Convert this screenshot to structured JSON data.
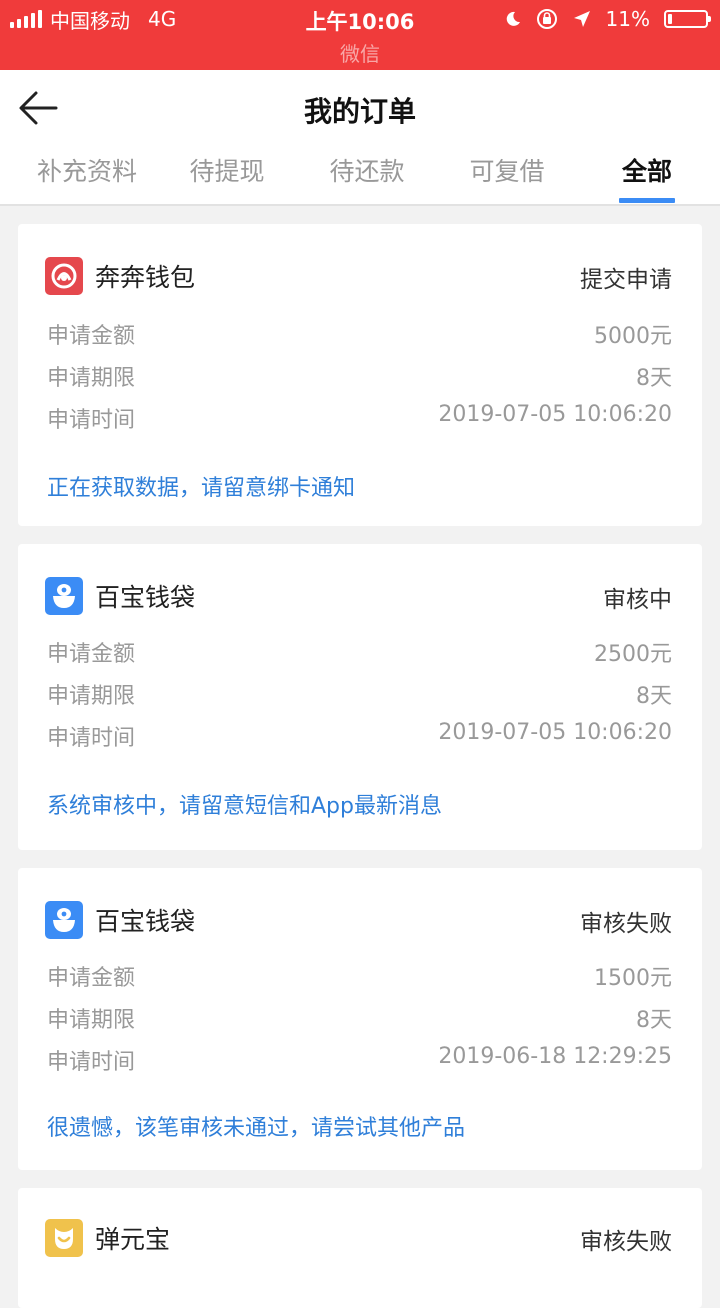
{
  "status_bar": {
    "carrier": "中国移动",
    "network": "4G",
    "time": "上午10:06",
    "app_name": "微信",
    "battery": "11%",
    "battery_level": 0.11
  },
  "header": {
    "title": "我的订单",
    "tabs": [
      {
        "label": "补充资料",
        "active": false
      },
      {
        "label": "待提现",
        "active": false
      },
      {
        "label": "待还款",
        "active": false
      },
      {
        "label": "可复借",
        "active": false
      },
      {
        "label": "全部",
        "active": true
      }
    ]
  },
  "orders": [
    {
      "brand": "奔奔钱包",
      "logo": "benben-logo",
      "status": "提交申请",
      "amount_label": "申请金额",
      "amount": "5000元",
      "term_label": "申请期限",
      "term": "8天",
      "time_label": "申请时间",
      "time": "2019-07-05 10:06:20",
      "note": "正在获取数据，请留意绑卡通知"
    },
    {
      "brand": "百宝钱袋",
      "logo": "baibao-logo",
      "status": "审核中",
      "amount_label": "申请金额",
      "amount": "2500元",
      "term_label": "申请期限",
      "term": "8天",
      "time_label": "申请时间",
      "time": "2019-07-05 10:06:20",
      "note": "系统审核中，请留意短信和App最新消息"
    },
    {
      "brand": "百宝钱袋",
      "logo": "baibao-logo",
      "status": "审核失败",
      "amount_label": "申请金额",
      "amount": "1500元",
      "term_label": "申请期限",
      "term": "8天",
      "time_label": "申请时间",
      "time": "2019-06-18 12:29:25",
      "note": "很遗憾，该笔审核未通过，请尝试其他产品"
    },
    {
      "brand": "弹元宝",
      "logo": "danyuanbao-logo",
      "status": "审核失败"
    }
  ],
  "colors": {
    "status_bar": "#f03b3b",
    "accent": "#3b8cf5",
    "note_text": "#2f7fd9",
    "benben_logo": "#e5484d",
    "baibao_logo": "#3b8cf5",
    "danyuanbao_logo": "#f0c24c"
  }
}
